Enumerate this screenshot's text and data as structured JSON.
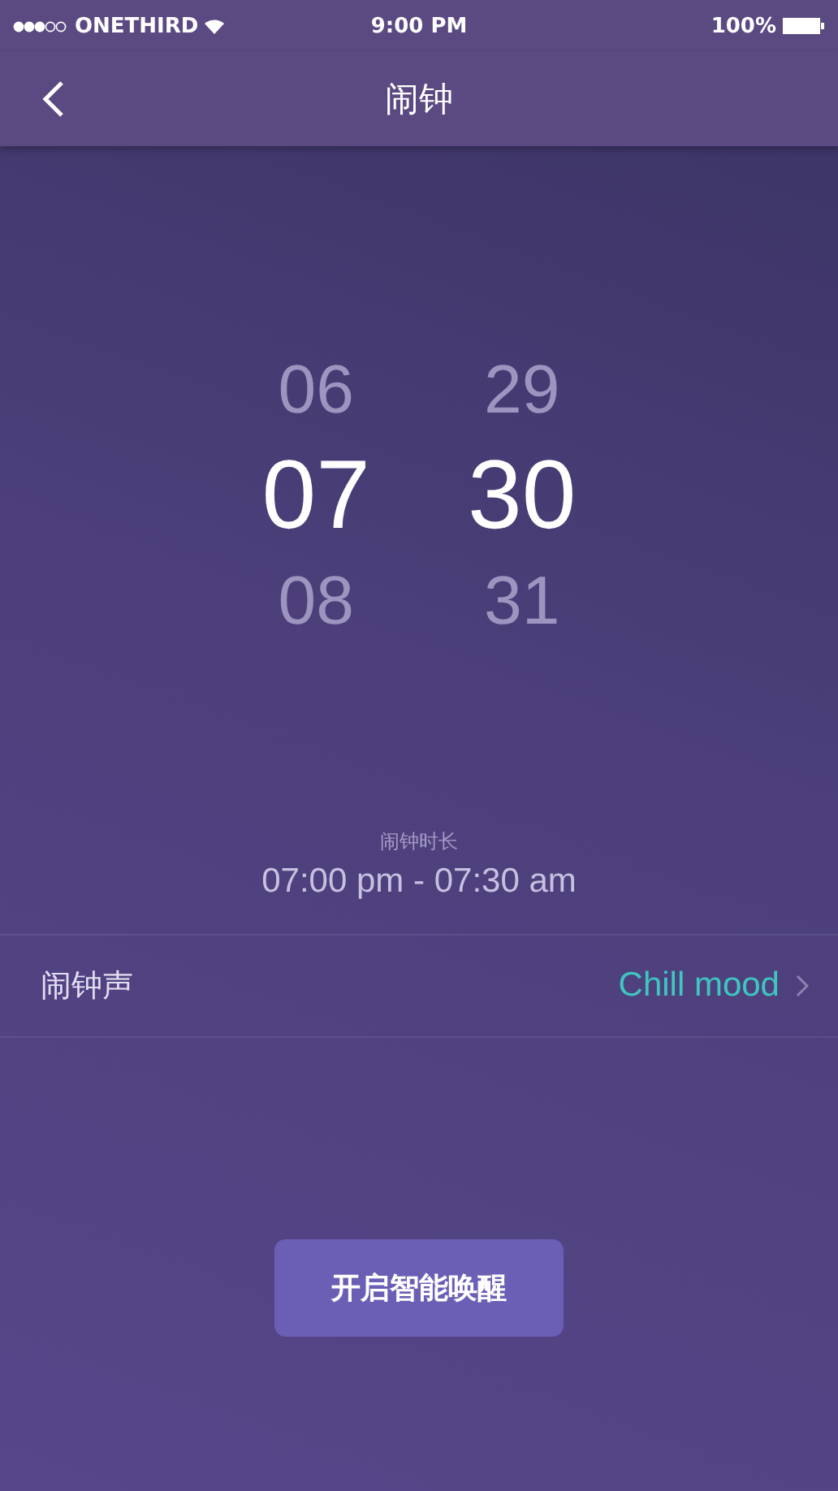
{
  "status_bar": {
    "carrier": "ONETHIRD",
    "time": "9:00 PM",
    "battery": "100%"
  },
  "nav": {
    "title": "闹钟"
  },
  "picker": {
    "columns": [
      {
        "items": [
          {
            "text": "06",
            "selected": false
          },
          {
            "text": "07",
            "selected": true
          },
          {
            "text": "08",
            "selected": false
          }
        ]
      },
      {
        "items": [
          {
            "text": "29",
            "selected": false
          },
          {
            "text": "30",
            "selected": true
          },
          {
            "text": "31",
            "selected": false
          }
        ]
      }
    ]
  },
  "duration": {
    "label": "闹钟时长",
    "value": "07:00 pm - 07:30 am"
  },
  "sound_row": {
    "label": "闹钟声",
    "value": "Chill mood"
  },
  "button": {
    "label": "开启智能唤醒"
  }
}
